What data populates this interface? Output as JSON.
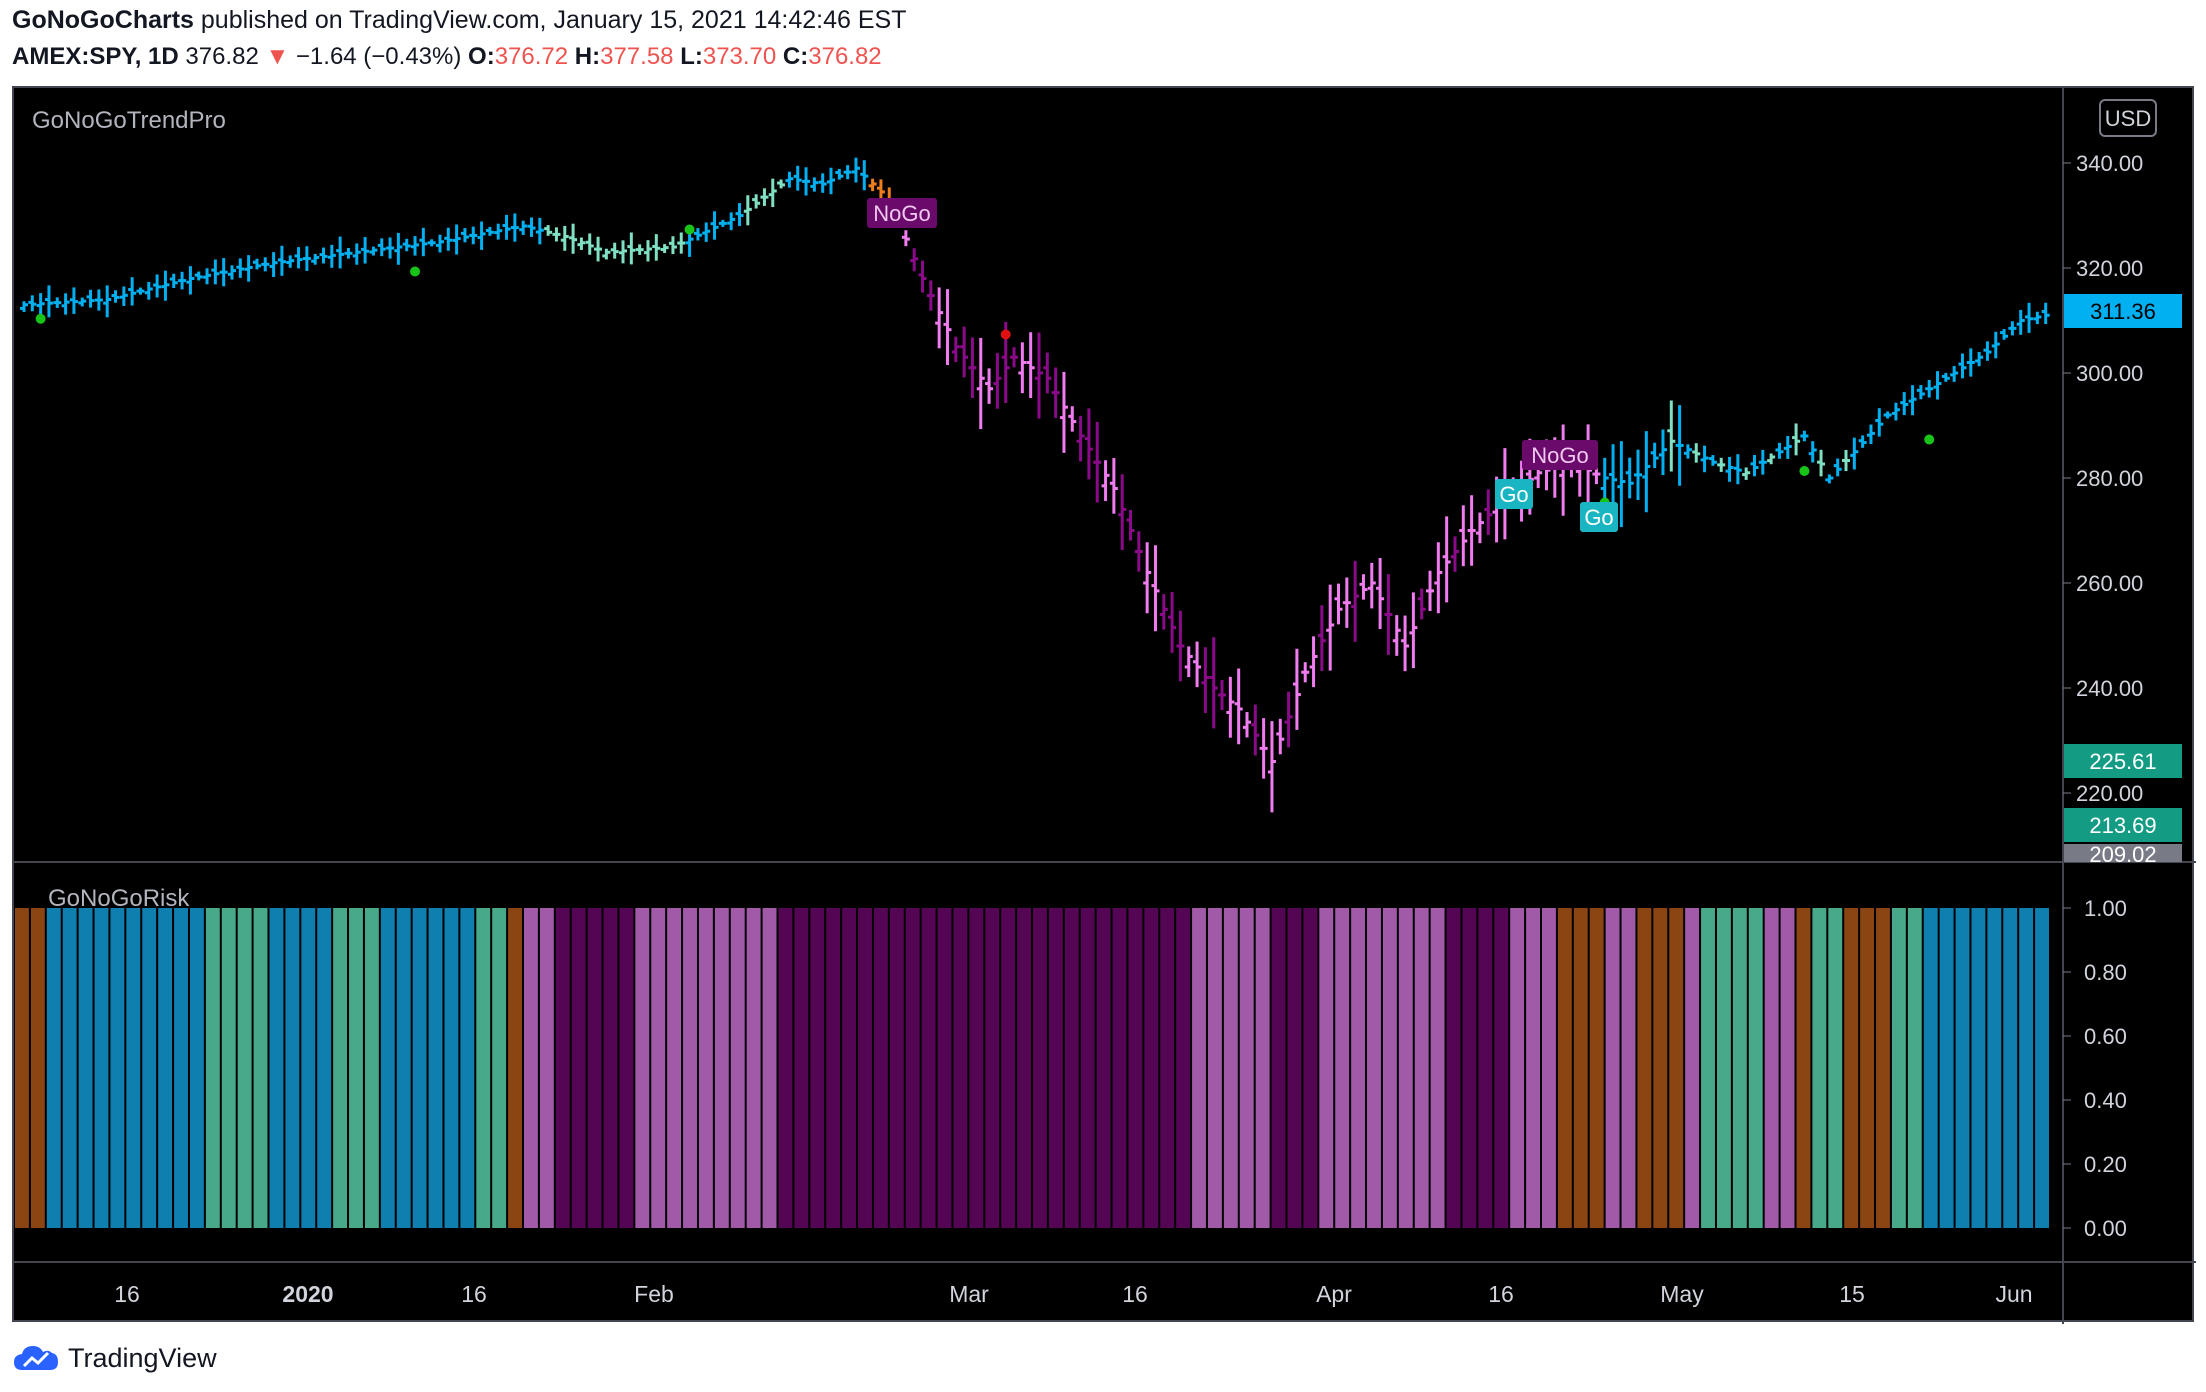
{
  "header": {
    "author": "GoNoGoCharts",
    "published": "published on TradingView.com, January 15, 2021 14:42:46 EST",
    "symbol": "AMEX:SPY, 1D",
    "last": "376.82",
    "change_arrow": "▼",
    "change": "−1.64 (−0.43%)",
    "o_label": "O:",
    "o": "376.72",
    "h_label": "H:",
    "h": "377.58",
    "l_label": "L:",
    "l": "373.70",
    "c_label": "C:",
    "c": "376.82"
  },
  "price_pane": {
    "indicator": "GoNoGoTrendPro",
    "currency_button": "USD",
    "ticks": [
      "340.00",
      "320.00",
      "300.00",
      "280.00",
      "260.00",
      "240.00",
      "220.00"
    ],
    "badges": [
      {
        "text": "311.36",
        "color": "#00b0f0"
      },
      {
        "text": "225.61",
        "color": "#139b84"
      },
      {
        "text": "213.69",
        "color": "#139b84"
      },
      {
        "text": "209.02",
        "color": "#787b86"
      }
    ],
    "signals": [
      "NoGo",
      "NoGo",
      "Go",
      "Go"
    ]
  },
  "risk_pane": {
    "indicator": "GoNoGoRisk",
    "ticks": [
      "1.00",
      "0.80",
      "0.60",
      "0.40",
      "0.20",
      "0.00"
    ]
  },
  "time_axis": [
    "16",
    "2020",
    "16",
    "Feb",
    "Mar",
    "16",
    "Apr",
    "16",
    "May",
    "15",
    "Jun"
  ],
  "footer": {
    "brand": "TradingView",
    "logo_icon": "tradingview-cloud-icon"
  },
  "colors": {
    "go_strong": "#00b0f0",
    "go_weak": "#7fe0c4",
    "nogo_weak": "#f07cf0",
    "nogo_strong": "#8a0a8a",
    "amber": "#f07d1b",
    "risk_orange": "#8b4513",
    "risk_blue": "#0f7fb0",
    "risk_green": "#48a88a",
    "risk_mauve": "#a15aa8",
    "risk_purple": "#540654"
  }
}
